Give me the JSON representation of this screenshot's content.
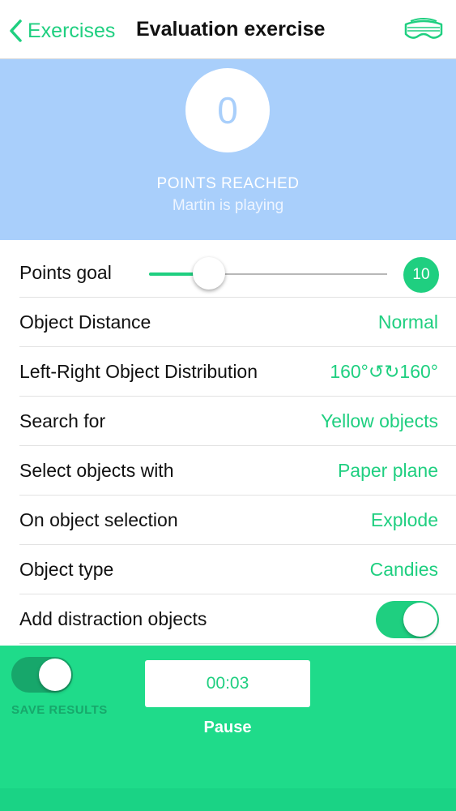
{
  "nav": {
    "back_label": "Exercises",
    "title": "Evaluation exercise",
    "headset_icon": "vr-headset-icon"
  },
  "score": {
    "value": "0",
    "label": "POINTS REACHED",
    "player_text": "Martin is playing"
  },
  "settings": {
    "points_goal": {
      "label": "Points goal",
      "value": "10",
      "slider_fraction": 0.25
    },
    "object_distance": {
      "label": "Object Distance",
      "value": "Normal"
    },
    "distribution": {
      "label": "Left-Right Object Distribution",
      "value": "160°↺↻160°"
    },
    "search_for": {
      "label": "Search for",
      "value": "Yellow objects"
    },
    "select_with": {
      "label": "Select objects with",
      "value": "Paper plane"
    },
    "on_selection": {
      "label": "On object selection",
      "value": "Explode"
    },
    "object_type": {
      "label": "Object type",
      "value": "Candies"
    },
    "distraction": {
      "label": "Add distraction objects",
      "enabled": true
    }
  },
  "bottom": {
    "save_results_label": "SAVE RESULTS",
    "save_results_enabled": true,
    "timer": "00:03",
    "pause_label": "Pause"
  },
  "colors": {
    "accent": "#1fcf80",
    "score_panel": "#a9cffb",
    "bottom_panel": "#1fdb8a"
  }
}
